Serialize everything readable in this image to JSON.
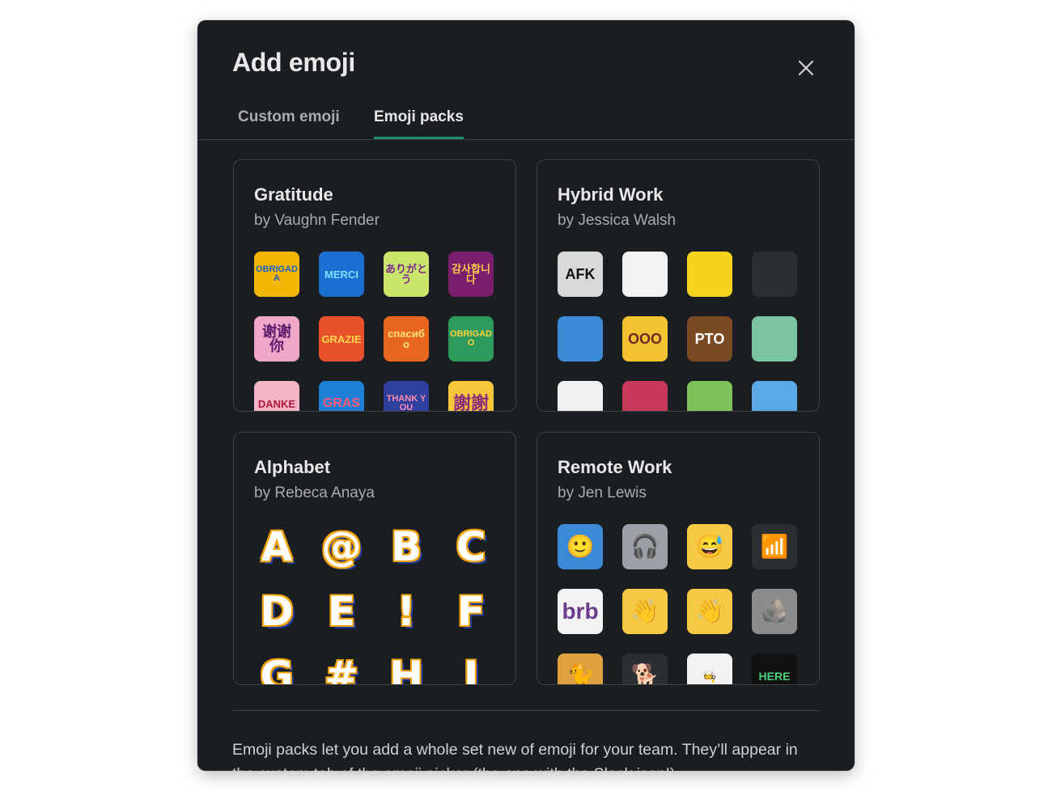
{
  "modal": {
    "title": "Add emoji",
    "close_icon": "close-icon",
    "tabs": [
      {
        "label": "Custom emoji",
        "active": false
      },
      {
        "label": "Emoji packs",
        "active": true
      }
    ],
    "accent_color": "#1f8d6e",
    "packs": [
      {
        "title": "Gratitude",
        "author": "by Vaughn Fender",
        "emoji": [
          {
            "text": "OBRIGADA",
            "icon": "obrigada-sticker-icon",
            "bg": "#f2b705",
            "fg": "#1e5fbf"
          },
          {
            "text": "MERCI",
            "icon": "merci-sticker-icon",
            "bg": "#1a6fd1",
            "fg": "#7ee0ff"
          },
          {
            "text": "ありがとう",
            "icon": "arigatou-sticker-icon",
            "bg": "#c9e66b",
            "fg": "#7a2a8c"
          },
          {
            "text": "감사합니다",
            "icon": "gamsahamnida-sticker-icon",
            "bg": "#7b1e6e",
            "fg": "#f7c84a"
          },
          {
            "text": "谢谢你",
            "icon": "xiexie-sticker-icon",
            "bg": "#f0a6c8",
            "fg": "#5a1a6b"
          },
          {
            "text": "GRAZIE",
            "icon": "grazie-sticker-icon",
            "bg": "#e8512c",
            "fg": "#ffd84d"
          },
          {
            "text": "спасибо",
            "icon": "spasibo-sticker-icon",
            "bg": "#e8671e",
            "fg": "#ffe27a"
          },
          {
            "text": "OBRIGADO",
            "icon": "obrigado-sticker-icon",
            "bg": "#2b9a5a",
            "fg": "#ffd23f"
          },
          {
            "text": "DANKE",
            "icon": "danke-sticker-icon",
            "bg": "#f3b4c6",
            "fg": "#b0193f"
          },
          {
            "text": "GRAS",
            "icon": "gracias-sticker-icon",
            "bg": "#1d7fd6",
            "fg": "#ff5a78"
          },
          {
            "text": "THANK YOU",
            "icon": "thank-you-sticker-icon",
            "bg": "#2f3f9e",
            "fg": "#ff8fb1"
          },
          {
            "text": "謝謝",
            "icon": "xiexie-traditional-sticker-icon",
            "bg": "#f7c63a",
            "fg": "#8a2a7c"
          }
        ]
      },
      {
        "title": "Hybrid Work",
        "author": "by Jessica Walsh",
        "emoji": [
          {
            "text": "AFK",
            "icon": "afk-keycap-icon",
            "bg": "#d9d9d9",
            "fg": "#111111"
          },
          {
            "text": "",
            "icon": "slippers-icon",
            "bg": "#f3f3f3",
            "fg": "#e57aa0"
          },
          {
            "text": "",
            "icon": "car-sign-icon",
            "bg": "#f6d21e",
            "fg": "#111111"
          },
          {
            "text": "",
            "icon": "burning-laptop-icon",
            "bg": "#2b2e33",
            "fg": "#ff6a2b"
          },
          {
            "text": "",
            "icon": "backpack-icon",
            "bg": "#3a8ad6",
            "fg": "#ff7aa8"
          },
          {
            "text": "OOO",
            "icon": "ooo-note-icon",
            "bg": "#f2c230",
            "fg": "#6b2a2a"
          },
          {
            "text": "PTO",
            "icon": "pto-suitcase-icon",
            "bg": "#7a4a22",
            "fg": "#ffffff"
          },
          {
            "text": "",
            "icon": "face-mask-icon",
            "bg": "#7bc4a2",
            "fg": "#2f7a58"
          },
          {
            "text": "",
            "icon": "melting-clock-icon",
            "bg": "#f1f1f1",
            "fg": "#333333"
          },
          {
            "text": "",
            "icon": "coffee-shop-icon",
            "bg": "#c73a5a",
            "fg": "#ffffff"
          },
          {
            "text": "",
            "icon": "home-icon",
            "bg": "#7ec05a",
            "fg": "#ffffff"
          },
          {
            "text": "",
            "icon": "office-building-icon",
            "bg": "#5aa9e6",
            "fg": "#ffffff"
          }
        ]
      },
      {
        "title": "Alphabet",
        "author": "by Rebeca Anaya",
        "emoji": [
          {
            "text": "A",
            "icon": "letter-a-icon"
          },
          {
            "text": "@",
            "icon": "at-sign-icon"
          },
          {
            "text": "B",
            "icon": "letter-b-icon"
          },
          {
            "text": "C",
            "icon": "letter-c-icon"
          },
          {
            "text": "D",
            "icon": "letter-d-icon"
          },
          {
            "text": "E",
            "icon": "letter-e-icon"
          },
          {
            "text": "!",
            "icon": "exclamation-icon"
          },
          {
            "text": "F",
            "icon": "letter-f-icon"
          },
          {
            "text": "G",
            "icon": "letter-g-icon"
          },
          {
            "text": "#",
            "icon": "hash-icon"
          },
          {
            "text": "H",
            "icon": "letter-h-icon"
          },
          {
            "text": "I",
            "icon": "letter-i-icon"
          }
        ]
      },
      {
        "title": "Remote Work",
        "author": "by Jen Lewis",
        "emoji": [
          {
            "text": "🙂",
            "icon": "video-call-grid-icon",
            "bg": "#3a8ad6",
            "fg": "#ffd23f"
          },
          {
            "text": "🎧",
            "icon": "headphones-laptop-icon",
            "bg": "#9aa0a6",
            "fg": "#222222"
          },
          {
            "text": "😅",
            "icon": "confused-faces-icon",
            "bg": "#f6c945",
            "fg": "#c0392b"
          },
          {
            "text": "📶",
            "icon": "no-wifi-icon",
            "bg": "#2b2e33",
            "fg": "#d22a2a"
          },
          {
            "text": "brb",
            "icon": "brb-chef-icon",
            "bg": "#f3f3f3",
            "fg": "#6b3b8c"
          },
          {
            "text": "👋",
            "icon": "waving-face-icon",
            "bg": "#f6c945",
            "fg": "#8a5a00"
          },
          {
            "text": "👋",
            "icon": "waving-face-left-icon",
            "bg": "#f6c945",
            "fg": "#8a5a00"
          },
          {
            "text": "🪨",
            "icon": "stacked-stones-icon",
            "bg": "#8c8c8c",
            "fg": "#eeeeee"
          },
          {
            "text": "🐈",
            "icon": "cat-keyboard-icon",
            "bg": "#e0a040",
            "fg": "#5a3a10"
          },
          {
            "text": "🐕",
            "icon": "dog-leash-icon",
            "bg": "#2b2e33",
            "fg": "#e0a040"
          },
          {
            "text": "🧑‍🍳",
            "icon": "chef-icon",
            "bg": "#f3f3f3",
            "fg": "#f6c945"
          },
          {
            "text": "HERE",
            "icon": "hanging-sign-icon",
            "bg": "#111111",
            "fg": "#4ad27a"
          }
        ]
      }
    ],
    "footer": {
      "text": "Emoji packs let you add a whole set new of emoji for your team. They’ll appear in the custom tab of the emoji picker (the one with the Slack icon!)"
    }
  }
}
